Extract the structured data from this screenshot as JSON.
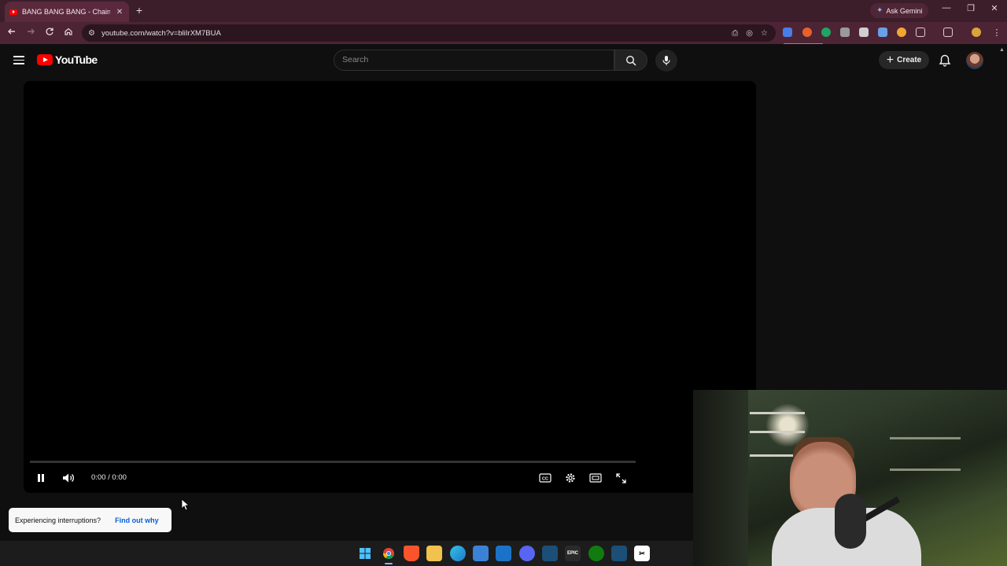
{
  "browser": {
    "tab_title": "BANG BANG BANG - Chainsaw",
    "tab_close": "✕",
    "new_tab": "+",
    "ask_gemini": "Ask Gemini",
    "url": "youtube.com/watch?v=bliIrXM7BUA"
  },
  "youtube": {
    "logo_text": "YouTube",
    "search_placeholder": "Search",
    "create_label": "Create"
  },
  "player": {
    "time": "0:00 / 0:00",
    "progress": 0
  },
  "toast": {
    "message": "Experiencing interruptions?",
    "link": "Find out why"
  },
  "colors": {
    "tab_strip": "#3c1e2b",
    "toolbar": "#4d2434",
    "youtube_red": "#ff0000",
    "link_blue": "#065fd4"
  },
  "taskbar_icons": [
    "windows-start-icon",
    "chrome-icon",
    "brave-icon",
    "file-explorer-icon",
    "edge-icon",
    "store-icon",
    "outlook-icon",
    "discord-icon",
    "steam-icon",
    "epic-games-icon",
    "xbox-icon",
    "steam-alt-icon",
    "capcut-icon"
  ]
}
